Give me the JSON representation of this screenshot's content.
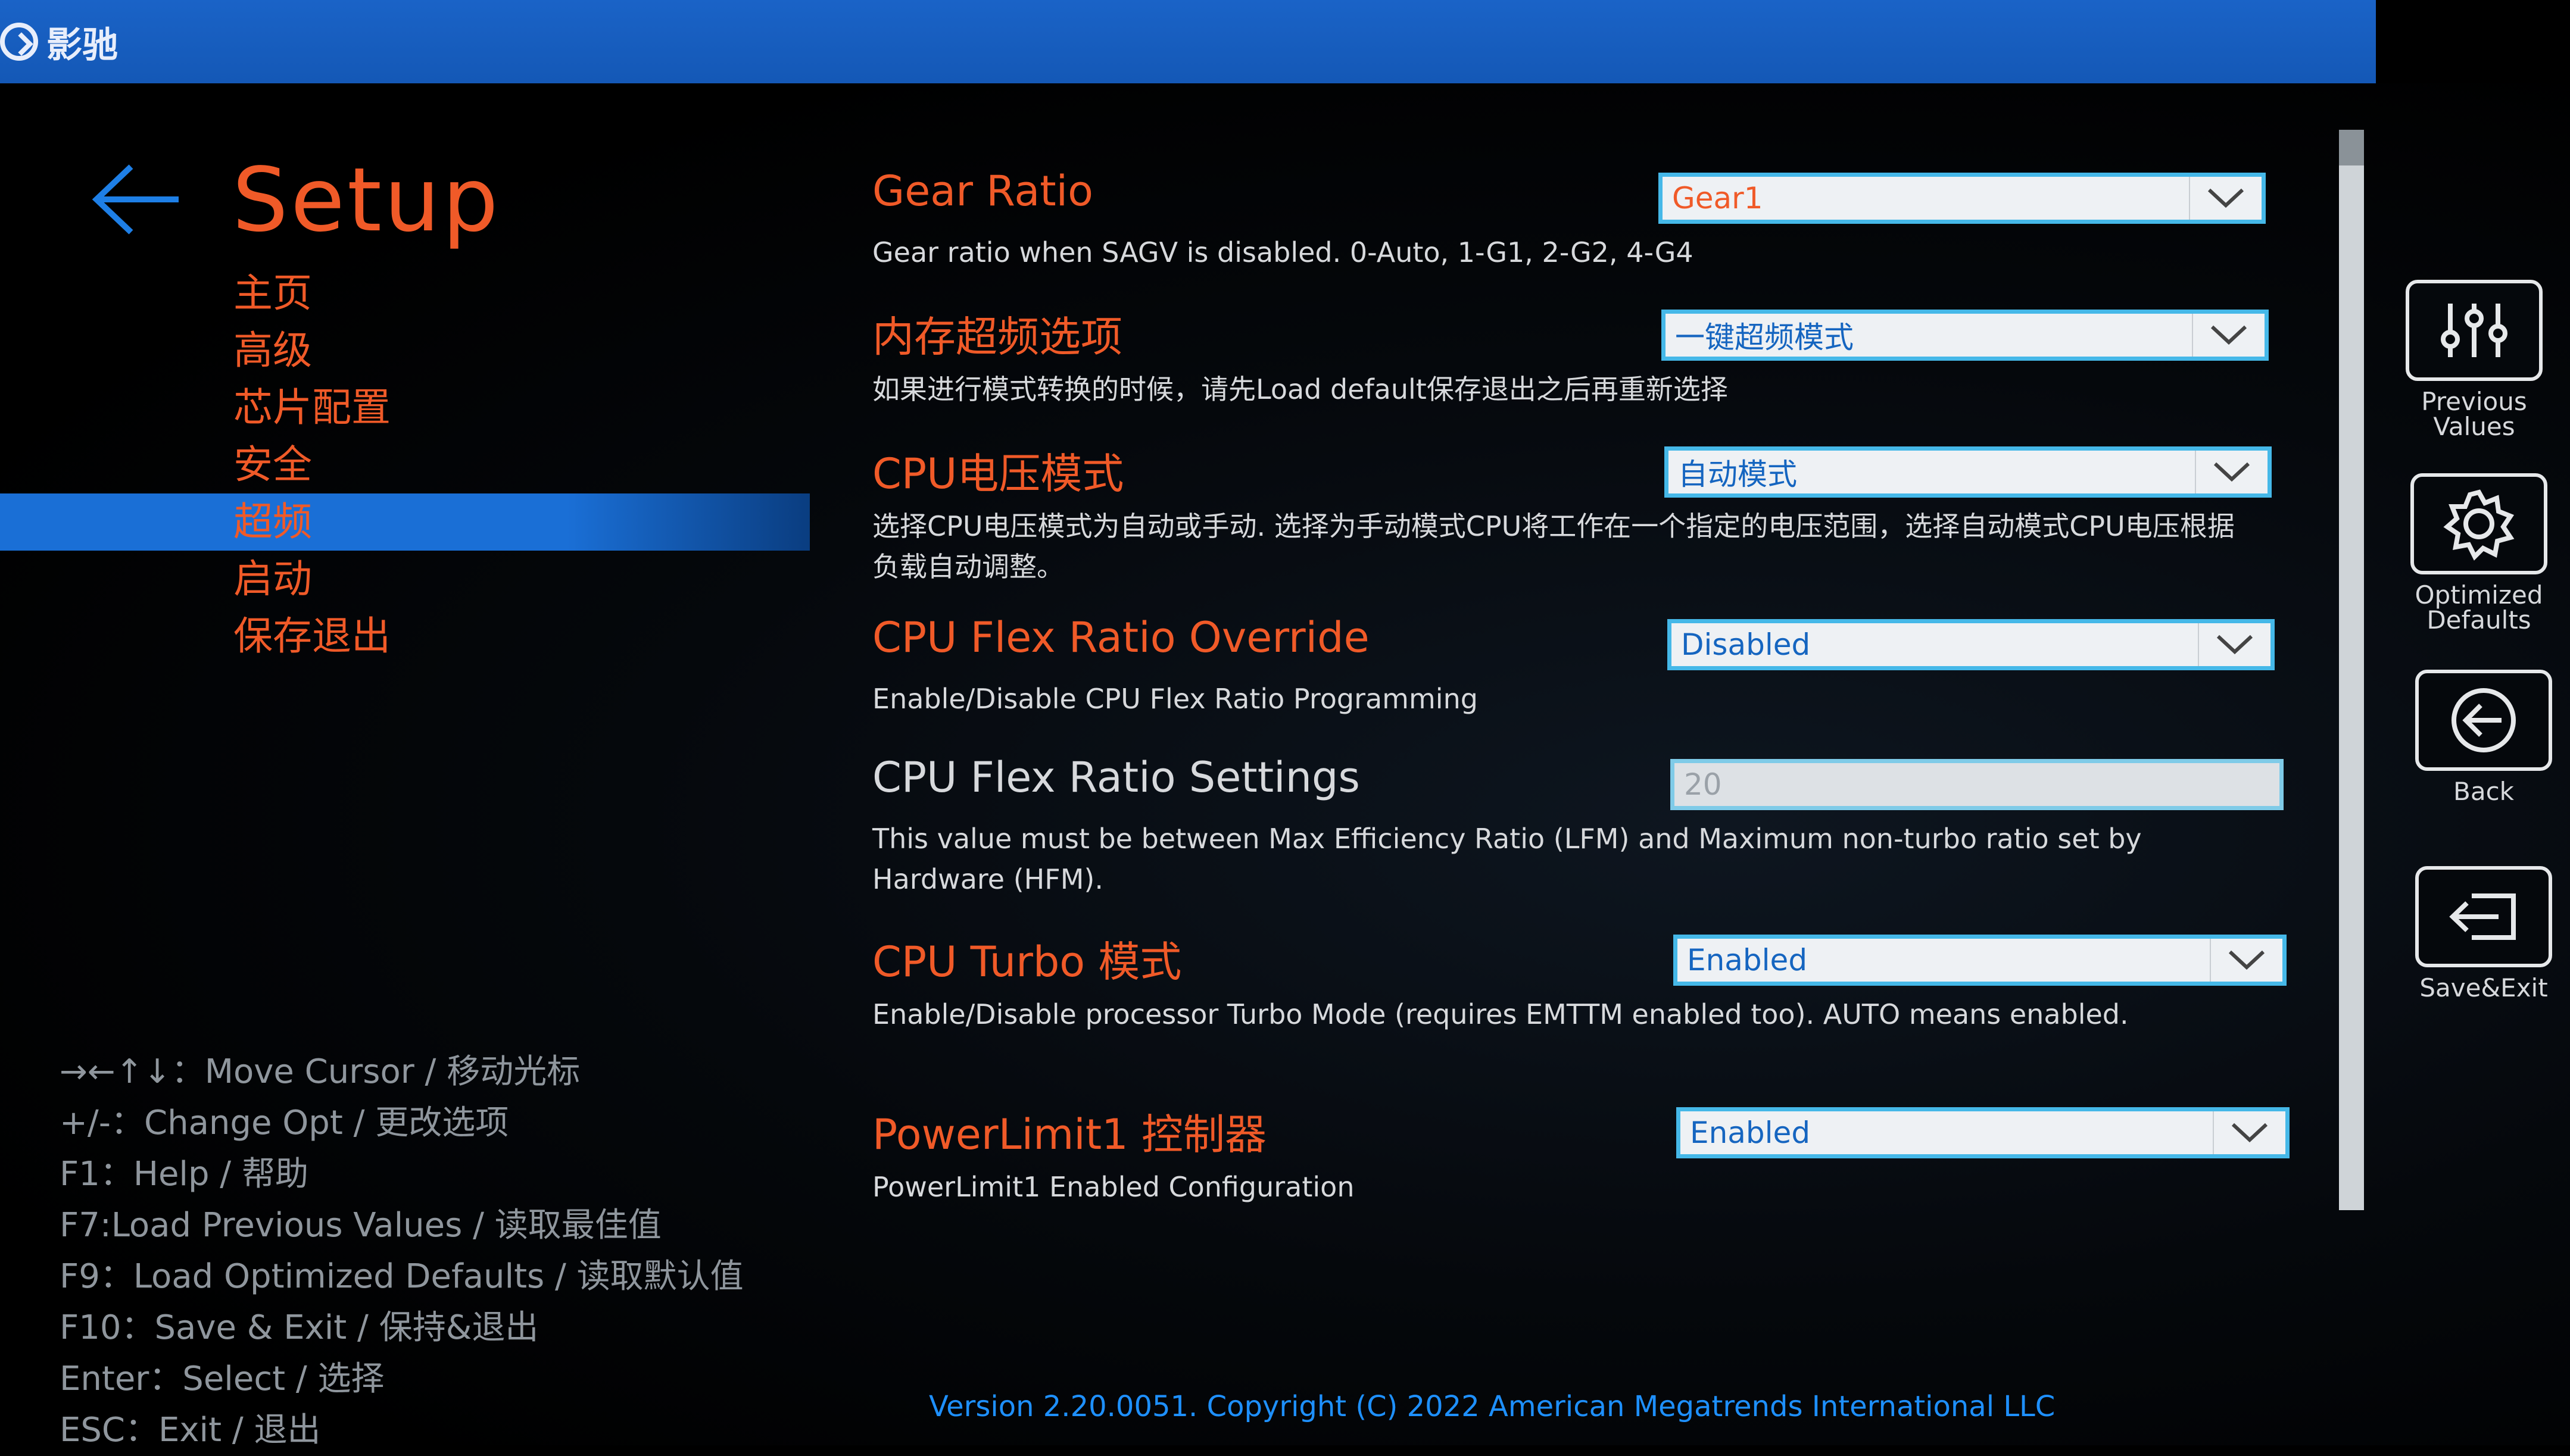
{
  "brand": {
    "name": "影驰"
  },
  "page": {
    "title": "Setup"
  },
  "nav": {
    "items": [
      {
        "label": "主页",
        "active": false
      },
      {
        "label": "高级",
        "active": false
      },
      {
        "label": "芯片配置",
        "active": false
      },
      {
        "label": "安全",
        "active": false
      },
      {
        "label": "超频",
        "active": true
      },
      {
        "label": "启动",
        "active": false
      },
      {
        "label": "保存退出",
        "active": false
      }
    ]
  },
  "settings": [
    {
      "label": "Gear Ratio",
      "desc": "Gear ratio when SAGV is disabled. 0-Auto, 1-G1, 2-G2, 4-G4",
      "value": "Gear1"
    },
    {
      "label": "内存超频选项",
      "desc": "如果进行模式转换的时候，请先Load default保存退出之后再重新选择",
      "value": "一键超频模式"
    },
    {
      "label": "CPU电压模式",
      "desc": "选择CPU电压模式为自动或手动. 选择为手动模式CPU将工作在一个指定的电压范围，选择自动模式CPU电压根据负载自动调整。",
      "value": "自动模式"
    },
    {
      "label": "CPU Flex Ratio Override",
      "desc": "Enable/Disable CPU Flex Ratio Programming",
      "value": "Disabled"
    },
    {
      "label": "CPU Flex Ratio Settings",
      "desc": "This value must be between Max Efficiency Ratio (LFM) and Maximum non-turbo ratio set by Hardware (HFM).",
      "value": "20"
    },
    {
      "label": "CPU Turbo 模式",
      "desc": "Enable/Disable processor Turbo Mode (requires EMTTM enabled too). AUTO means enabled.",
      "value": "Enabled"
    },
    {
      "label": "PowerLimit1 控制器",
      "desc": "PowerLimit1 Enabled Configuration",
      "value": "Enabled"
    }
  ],
  "help": [
    "→←↑↓：Move Cursor / 移动光标",
    "+/-：Change Opt / 更改选项",
    "F1：Help / 帮助",
    "F7:Load Previous Values / 读取最佳值",
    "F9：Load Optimized Defaults / 读取默认值",
    "F10：Save & Exit / 保持&退出",
    "Enter：Select / 选择",
    "ESC：Exit / 退出"
  ],
  "right_panel": {
    "previous_values": "Previous Values",
    "optimized_defaults": "Optimized Defaults",
    "back": "Back",
    "save_exit": "Save&Exit"
  },
  "footer": {
    "version": "Version 2.20.0051. Copyright (C) 2022 American Megatrends International LLC"
  },
  "colors": {
    "accent": "#f05a28",
    "nav_active": "#1a6fd6",
    "topbar": "#1458b6",
    "select_border": "#45b8e8",
    "version_text": "#1e90ff"
  }
}
